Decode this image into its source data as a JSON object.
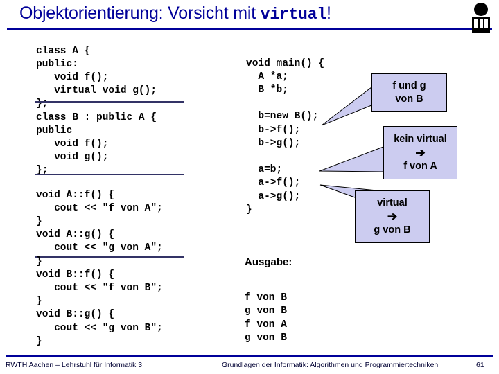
{
  "title": {
    "prefix": "Objektorientierung: Vorsicht mit ",
    "keyword": "virtual",
    "suffix": "!"
  },
  "logo": {
    "name": "rwth-informatik-logo"
  },
  "code": {
    "class_definitions": "class A {\npublic:\n   void f();\n   virtual void g();\n};\nclass B : public A {\npublic\n   void f();\n   void g();\n};",
    "method_implementations": "void A::f() {\n   cout << \"f von A\";\n}\nvoid A::g() {\n   cout << \"g von A\";\n}\nvoid B::f() {\n   cout << \"f von B\";\n}\nvoid B::g() {\n   cout << \"g von B\";\n}",
    "main_function": "void main() {\n  A *a;\n  B *b;\n\n  b=new B();\n  b->f();\n  b->g();\n\n  a=b;\n  a->f();\n  a->g();\n}"
  },
  "output": {
    "label": "Ausgabe:",
    "lines": "f von B\ng von B\nf von A\ng von B"
  },
  "callouts": [
    {
      "line1": "f und g",
      "line2": "von B",
      "arrow": ""
    },
    {
      "line1": "kein virtual",
      "arrow": "➔",
      "line2": "f von A"
    },
    {
      "line1": "virtual",
      "arrow": "➔",
      "line2": "g von B"
    }
  ],
  "footer": {
    "left": "RWTH Aachen – Lehrstuhl für Informatik 3",
    "right": "Grundlagen der Informatik: Algorithmen und Programmiertechniken",
    "page": "61"
  },
  "colors": {
    "accent": "#000099",
    "callout_fill": "#CCCCF0",
    "text": "#000000"
  }
}
